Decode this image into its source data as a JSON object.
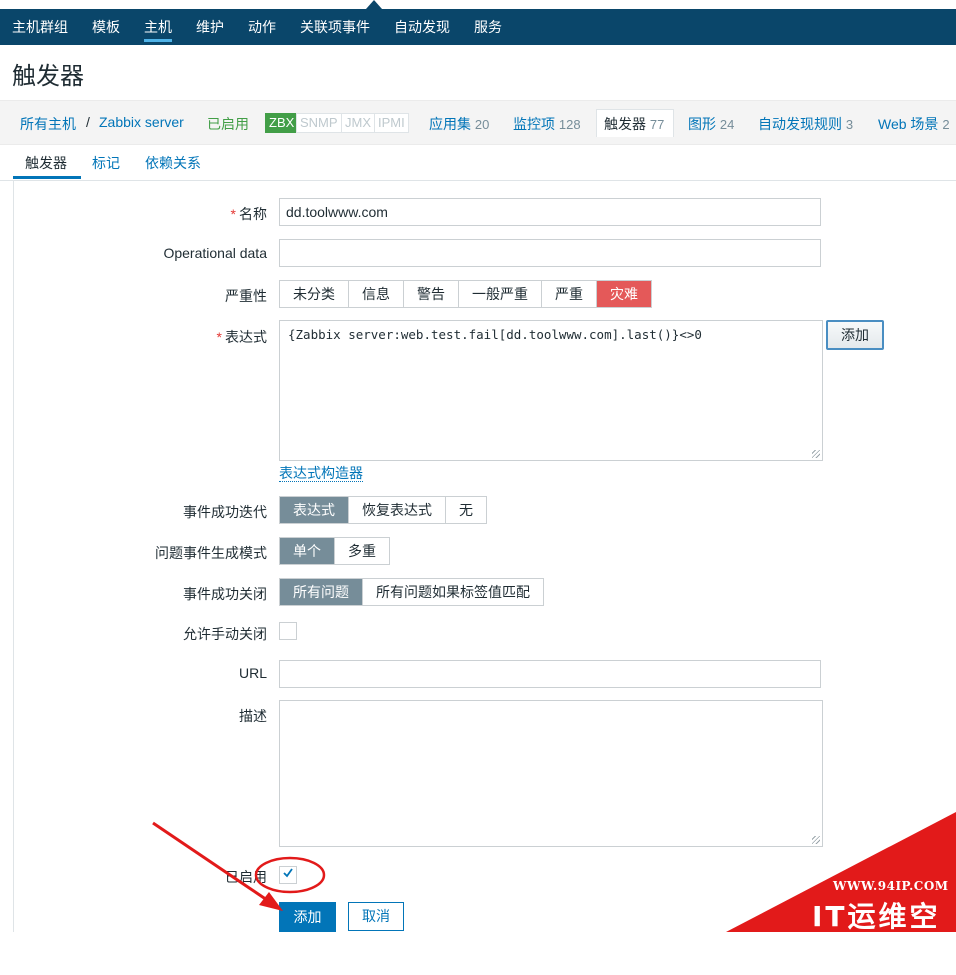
{
  "topnav": {
    "items": [
      "主机群组",
      "模板",
      "主机",
      "维护",
      "动作",
      "关联项事件",
      "自动发现",
      "服务"
    ],
    "active_index": 2
  },
  "page": {
    "title": "触发器"
  },
  "hostbar": {
    "all_hosts": "所有主机",
    "separator": "/",
    "host": "Zabbix server",
    "status": "已启用",
    "availability": [
      "ZBX",
      "SNMP",
      "JMX",
      "IPMI"
    ],
    "tabs": [
      {
        "label": "应用集",
        "count": "20"
      },
      {
        "label": "监控项",
        "count": "128"
      },
      {
        "label": "触发器",
        "count": "77"
      },
      {
        "label": "图形",
        "count": "24"
      },
      {
        "label": "自动发现规则",
        "count": "3"
      },
      {
        "label": "Web 场景",
        "count": "2"
      }
    ]
  },
  "subtabs": [
    "触发器",
    "标记",
    "依赖关系"
  ],
  "form": {
    "name_label": "名称",
    "name_value": "dd.toolwww.com",
    "opdata_label": "Operational data",
    "opdata_value": "",
    "severity_label": "严重性",
    "severity_options": [
      "未分类",
      "信息",
      "警告",
      "一般严重",
      "严重",
      "灾难"
    ],
    "severity_selected": "灾难",
    "expression_label": "表达式",
    "expression_value": "{Zabbix server:web.test.fail[dd.toolwww.com].last()}<>0",
    "expression_add": "添加",
    "expression_builder": "表达式构造器",
    "ok_event_label": "事件成功迭代",
    "ok_event_options": [
      "表达式",
      "恢复表达式",
      "无"
    ],
    "problem_mode_label": "问题事件生成模式",
    "problem_mode_options": [
      "单个",
      "多重"
    ],
    "ok_close_label": "事件成功关闭",
    "ok_close_options": [
      "所有问题",
      "所有问题如果标签值匹配"
    ],
    "manual_close_label": "允许手动关闭",
    "manual_close_checked": false,
    "url_label": "URL",
    "url_value": "",
    "description_label": "描述",
    "description_value": "",
    "enabled_label": "已启用",
    "enabled_checked": true,
    "submit_label": "添加",
    "cancel_label": "取消"
  },
  "watermark": {
    "url": "WWW.94IP.COM",
    "brand": "IT运维空间",
    "color": "#e21a1a"
  },
  "colors": {
    "nav_bg": "#0a466a",
    "link": "#0275b8",
    "selected_segment": "#768d99",
    "disaster": "#e45959",
    "enabled_green": "#429e47"
  }
}
